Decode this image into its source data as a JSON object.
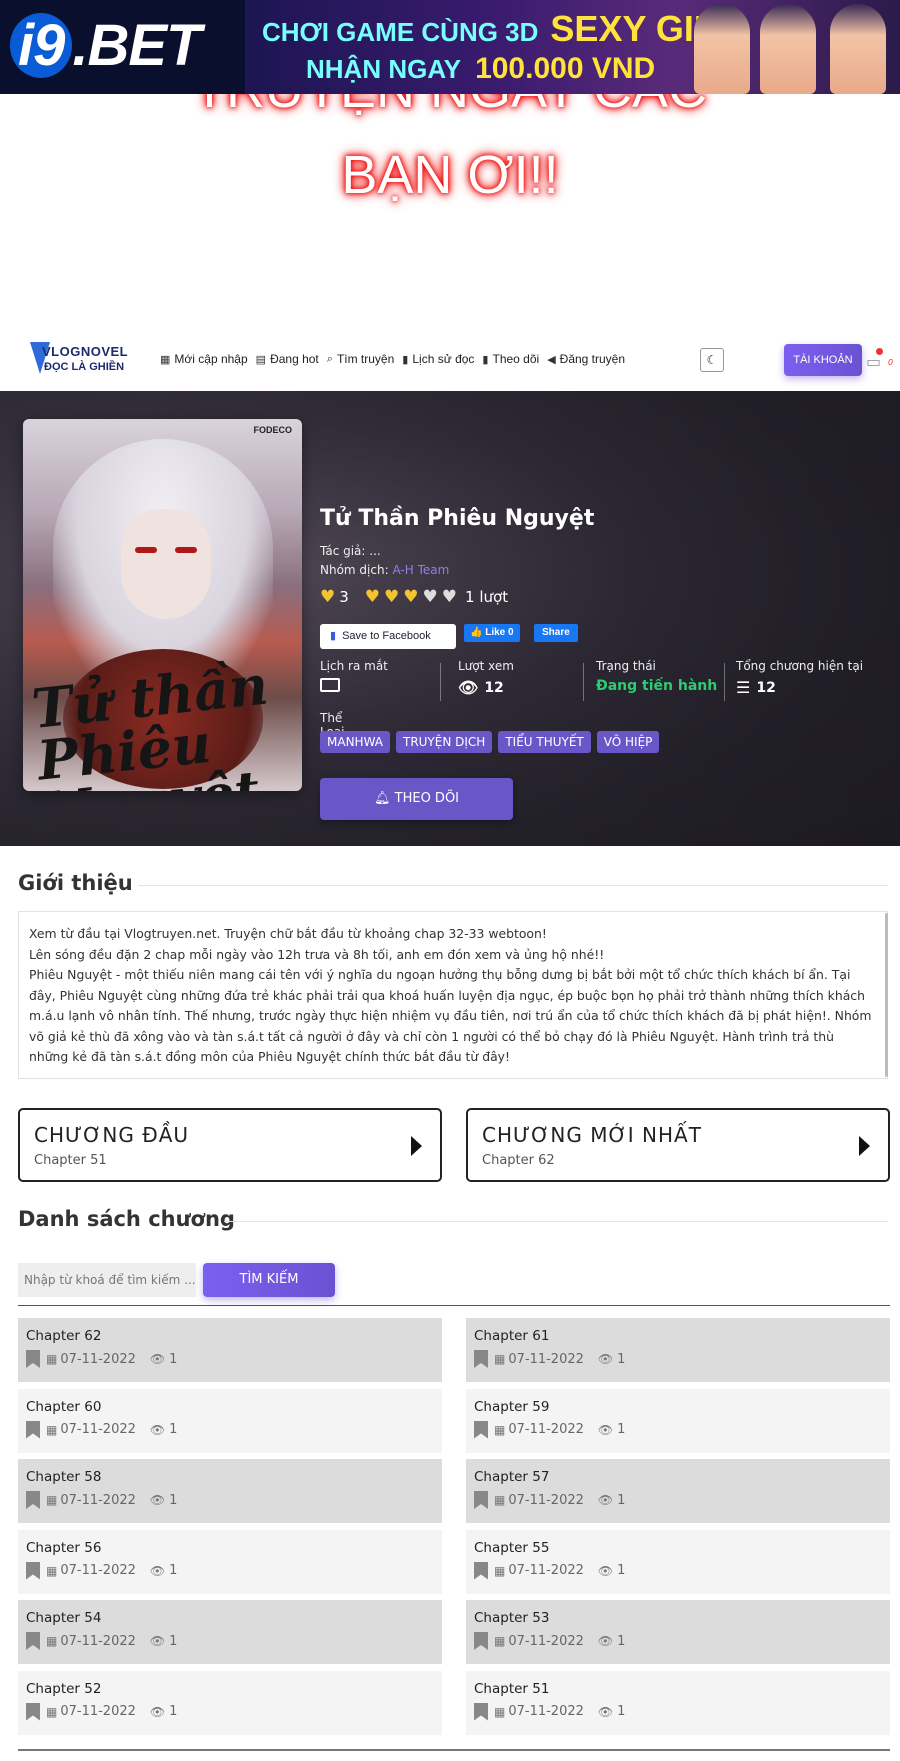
{
  "ad": {
    "brand_prefix": "i9",
    "brand_suffix": ".BET",
    "line1_a": "CHƠI GAME CÙNG 3D",
    "line1_b": "SEXY GIRL",
    "line2_a": "NHẬN NGAY",
    "line2_b": "100.000 VND"
  },
  "promo": {
    "line1": "TRUYỆN NGAY CÁC",
    "line2": "BẠN ƠI!!"
  },
  "nav": {
    "brand_top": "VLOGNOVEL",
    "brand_bottom": "ĐỌC LÀ GHIỀN",
    "items": [
      {
        "icon": "▦",
        "label": "Mới cập nhập"
      },
      {
        "icon": "▤",
        "label": "Đang hot"
      },
      {
        "icon": "⌕",
        "label": "Tìm truyện"
      },
      {
        "icon": "▮",
        "label": "Lịch sử đọc"
      },
      {
        "icon": "▮",
        "label": "Theo dõi"
      },
      {
        "icon": "◀",
        "label": "Đăng truyện"
      }
    ],
    "account": "TÀI KHOẢN",
    "notif_count": "0"
  },
  "story": {
    "title": "Tử Thần Phiêu Nguyệt",
    "author_label": "Tác giả:",
    "author": "...",
    "translator_label": "Nhóm dịch:",
    "translator": "A-H Team",
    "rating_value": "3",
    "rating_hearts": 3,
    "rating_max": 5,
    "rating_votes": "1 lượt",
    "fb_save": "Save to Facebook",
    "fb_like": "Like 0",
    "fb_share": "Share",
    "stats": {
      "release_label": "Lịch ra mắt",
      "views_label": "Lượt xem",
      "views": "12",
      "status_label": "Trạng thái",
      "status": "Đang tiến hành",
      "chapters_label": "Tổng chương hiện tại",
      "chapters": "12"
    },
    "genres_label": "Thể Loại",
    "genres": [
      "MANHWA",
      "TRUYỆN DỊCH",
      "TIỂU THUYẾT",
      "VÕ HIỆP"
    ],
    "follow": "THEO DÕI",
    "cover_publisher": "FODECO",
    "cover_title": "Tử thần Phiêu Nguyệt"
  },
  "intro": {
    "heading": "Giới thiệu",
    "paragraphs": [
      "Xem từ đầu tại Vlogtruyen.net. Truyện chữ bắt đầu từ khoảng chap 32-33 webtoon!",
      "Lên sóng đều đặn 2 chap mỗi ngày vào 12h trưa và 8h tối, anh em đón xem và ủng hộ nhé!!",
      "Phiêu Nguyệt - một thiếu niên mang cái tên với ý nghĩa du ngoạn hưởng thụ bỗng dưng bị bắt bởi một tổ chức thích khách bí ẩn. Tại đây, Phiêu Nguyệt cùng những đứa trẻ khác phải trải qua khoá huấn luyện địa ngục, ép buộc bọn họ phải trở thành những thích khách m.á.u lạnh vô nhân tính. Thế nhưng, trước ngày thực hiện nhiệm vụ đầu tiên, nơi trú ẩn của tổ chức thích khách đã bị phát hiện!. Nhóm võ giả kẻ thù đã xông vào và tàn s.á.t tất cả người ở đây và chỉ còn 1 người có thể bỏ chạy đó là Phiêu Nguyệt. Hành trình trả thù những kẻ đã tàn s.á.t đồng môn của Phiêu Nguyệt chính thức bắt đầu từ đây!"
    ]
  },
  "first_chapter": {
    "title": "CHƯƠNG ĐẦU",
    "chapter": "Chapter 51"
  },
  "latest_chapter": {
    "title": "CHƯƠNG MỚI NHẤT",
    "chapter": "Chapter 62"
  },
  "chapter_list": {
    "heading": "Danh sách chương",
    "search_placeholder": "Nhập từ khoá để tìm kiếm ...",
    "search_button": "TÌM KIẾM",
    "chapters": [
      {
        "name": "Chapter 62",
        "date": "07-11-2022",
        "views": "1"
      },
      {
        "name": "Chapter 61",
        "date": "07-11-2022",
        "views": "1"
      },
      {
        "name": "Chapter 60",
        "date": "07-11-2022",
        "views": "1"
      },
      {
        "name": "Chapter 59",
        "date": "07-11-2022",
        "views": "1"
      },
      {
        "name": "Chapter 58",
        "date": "07-11-2022",
        "views": "1"
      },
      {
        "name": "Chapter 57",
        "date": "07-11-2022",
        "views": "1"
      },
      {
        "name": "Chapter 56",
        "date": "07-11-2022",
        "views": "1"
      },
      {
        "name": "Chapter 55",
        "date": "07-11-2022",
        "views": "1"
      },
      {
        "name": "Chapter 54",
        "date": "07-11-2022",
        "views": "1"
      },
      {
        "name": "Chapter 53",
        "date": "07-11-2022",
        "views": "1"
      },
      {
        "name": "Chapter 52",
        "date": "07-11-2022",
        "views": "1"
      },
      {
        "name": "Chapter 51",
        "date": "07-11-2022",
        "views": "1"
      }
    ]
  },
  "colors": {
    "accent": "#6a57c7",
    "status_green": "#2ecc71",
    "heart": "#f4c430"
  }
}
